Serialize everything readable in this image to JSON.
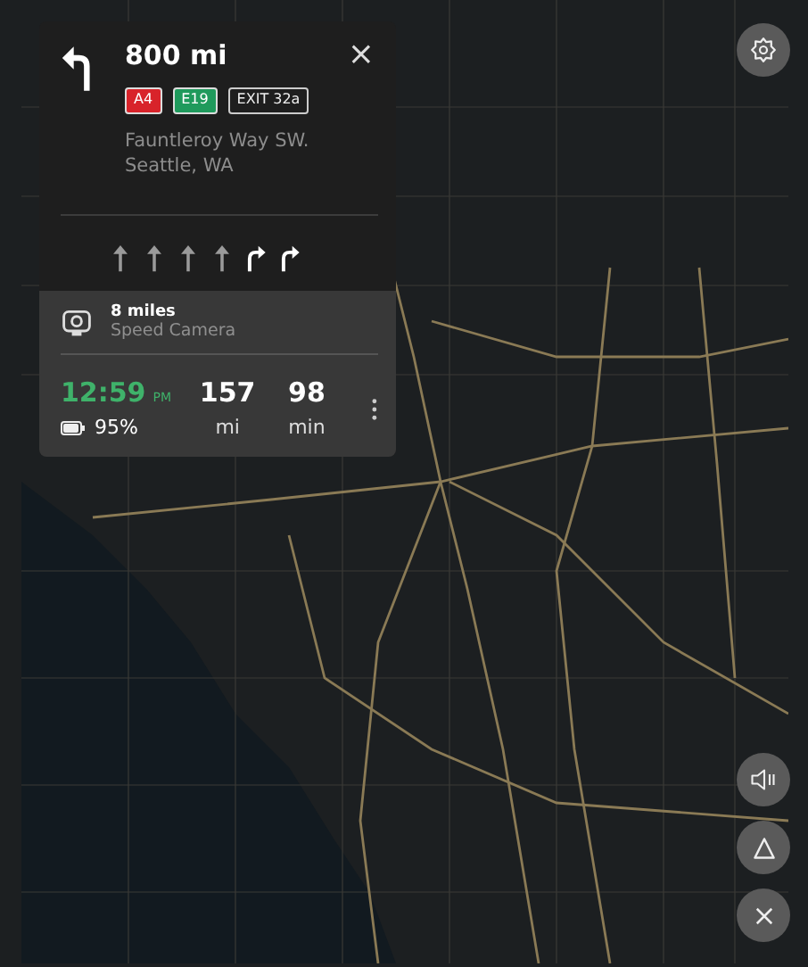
{
  "maneuver": {
    "distance": "800 mi",
    "close": "×"
  },
  "badges": [
    {
      "label": "A4",
      "kind": "filled",
      "color": "#d8232a"
    },
    {
      "label": "E19",
      "kind": "filled",
      "color": "#1f9a5c"
    },
    {
      "label": "EXIT 32a",
      "kind": "outline"
    }
  ],
  "address": [
    "Fauntleroy Way SW.",
    "Seattle, WA"
  ],
  "lanes": [
    {
      "kind": "straight",
      "highlighted": false
    },
    {
      "kind": "straight",
      "highlighted": false
    },
    {
      "kind": "straight",
      "highlighted": false
    },
    {
      "kind": "straight",
      "highlighted": false
    },
    {
      "kind": "right",
      "highlighted": true
    },
    {
      "kind": "right",
      "highlighted": true
    }
  ],
  "alert": {
    "distance": "8 miles",
    "label": "Speed Camera"
  },
  "trip": {
    "arrival_time": "12:59",
    "meridiem": "PM",
    "battery": "95%",
    "distance": "157",
    "distance_unit": "mi",
    "duration": "98",
    "duration_unit": "min"
  },
  "map_buttons": [
    {
      "kind": "volume"
    },
    {
      "kind": "navigate"
    },
    {
      "kind": "close"
    }
  ]
}
